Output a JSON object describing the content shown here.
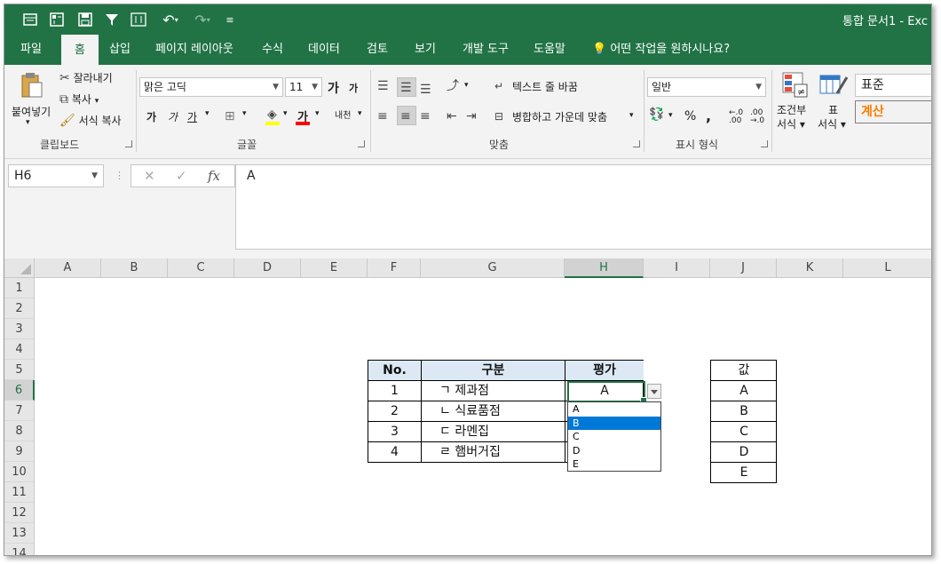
{
  "quick_access": {
    "title": "통합 문서1 - Exc",
    "icons": [
      "form-icon",
      "pivot-icon",
      "save-icon",
      "filter-icon",
      "sort-icon",
      "undo-icon",
      "redo-icon",
      "customize-icon"
    ]
  },
  "ribbon_tabs": [
    "파일",
    "홈",
    "삽입",
    "페이지 레이아웃",
    "수식",
    "데이터",
    "검토",
    "보기",
    "개발 도구",
    "도움말",
    "어떤 작업을 원하시나요?"
  ],
  "active_tab": "홈",
  "clipboard": {
    "paste": "붙여넣기",
    "cut": "잘라내기",
    "copy": "복사",
    "format_painter": "서식 복사",
    "group": "클립보드"
  },
  "font": {
    "name": "맑은 고딕",
    "size": "11",
    "grow": "가",
    "shrink": "가",
    "bold": "가",
    "italic": "가",
    "underline": "가",
    "font_color": "가",
    "phonetic": "내천",
    "group": "글꼴"
  },
  "alignment": {
    "wrap_text": "텍스트 줄 바꿈",
    "merge_center": "병합하고 가운데 맞춤",
    "orientation_label": "가",
    "group": "맞춤"
  },
  "number": {
    "format": "일반",
    "percent": "%",
    "comma": ",",
    "group": "표시 형식"
  },
  "styles": {
    "conditional": "조건부",
    "conditional2": "서식",
    "table": "표",
    "table2": "서식",
    "normal": "표준",
    "calc": "계산"
  },
  "formula_bar": {
    "name_box": "H6",
    "content": "A",
    "cancel": "✕",
    "enter": "✓",
    "fx": "fx"
  },
  "columns": [
    "A",
    "B",
    "C",
    "D",
    "E",
    "F",
    "G",
    "H",
    "I",
    "J",
    "K",
    "L"
  ],
  "rows": [
    "1",
    "2",
    "3",
    "4",
    "5",
    "6",
    "7",
    "8",
    "9",
    "10",
    "11",
    "12",
    "13",
    "14"
  ],
  "selected_cell": {
    "column": "H",
    "row": "6"
  },
  "table": {
    "headers": [
      "No.",
      "구분",
      "평가"
    ],
    "rows": [
      {
        "no": "1",
        "category": "ㄱ 제과점",
        "rating": "A"
      },
      {
        "no": "2",
        "category": "ㄴ 식료품점",
        "rating": ""
      },
      {
        "no": "3",
        "category": "ㄷ 라멘집",
        "rating": ""
      },
      {
        "no": "4",
        "category": "ㄹ 햄버거집",
        "rating": ""
      }
    ]
  },
  "value_list": {
    "header": "값",
    "values": [
      "A",
      "B",
      "C",
      "D",
      "E"
    ]
  },
  "dropdown": {
    "options": [
      "A",
      "B",
      "C",
      "D",
      "E"
    ],
    "highlighted": "B"
  },
  "colors": {
    "excel_green": "#217346",
    "header_fill": "#dce9f5",
    "highlight_blue": "#0078d7",
    "calc_orange": "#fa7d00"
  }
}
